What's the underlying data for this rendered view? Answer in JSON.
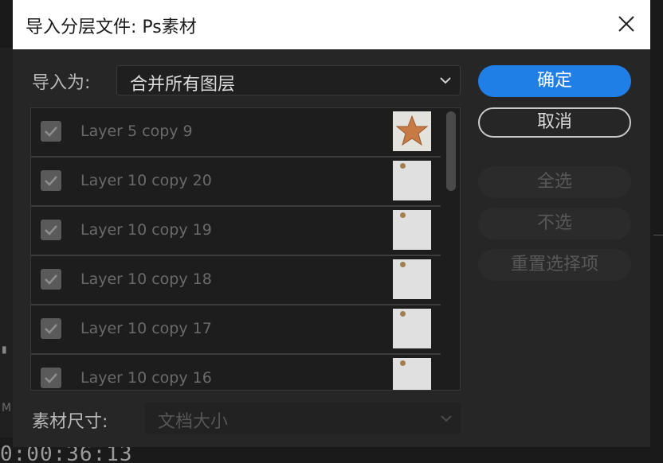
{
  "dialog": {
    "title": "导入分层文件: Ps素材",
    "close_icon": "close-icon"
  },
  "import_as": {
    "label": "导入为:",
    "selected": "合并所有图层"
  },
  "buttons": {
    "ok": "确定",
    "cancel": "取消",
    "select_all": "全选",
    "select_none": "不选",
    "reset": "重置选择项"
  },
  "layers": [
    {
      "name": "Layer 5 copy 9",
      "checked": true,
      "thumb": "star"
    },
    {
      "name": "Layer 10 copy 20",
      "checked": true,
      "thumb": "note"
    },
    {
      "name": "Layer 10 copy 19",
      "checked": true,
      "thumb": "note"
    },
    {
      "name": "Layer 10 copy 18",
      "checked": true,
      "thumb": "note"
    },
    {
      "name": "Layer 10 copy 17",
      "checked": true,
      "thumb": "note"
    },
    {
      "name": "Layer 10 copy 16",
      "checked": true,
      "thumb": "note"
    }
  ],
  "footage_size": {
    "label": "素材尺寸:",
    "selected": "文档大小"
  },
  "background": {
    "timecode": "0:00:36:13"
  },
  "colors": {
    "accent": "#1f7fe6",
    "dialog_bg": "#262626",
    "titlebar_bg": "#ffffff"
  }
}
